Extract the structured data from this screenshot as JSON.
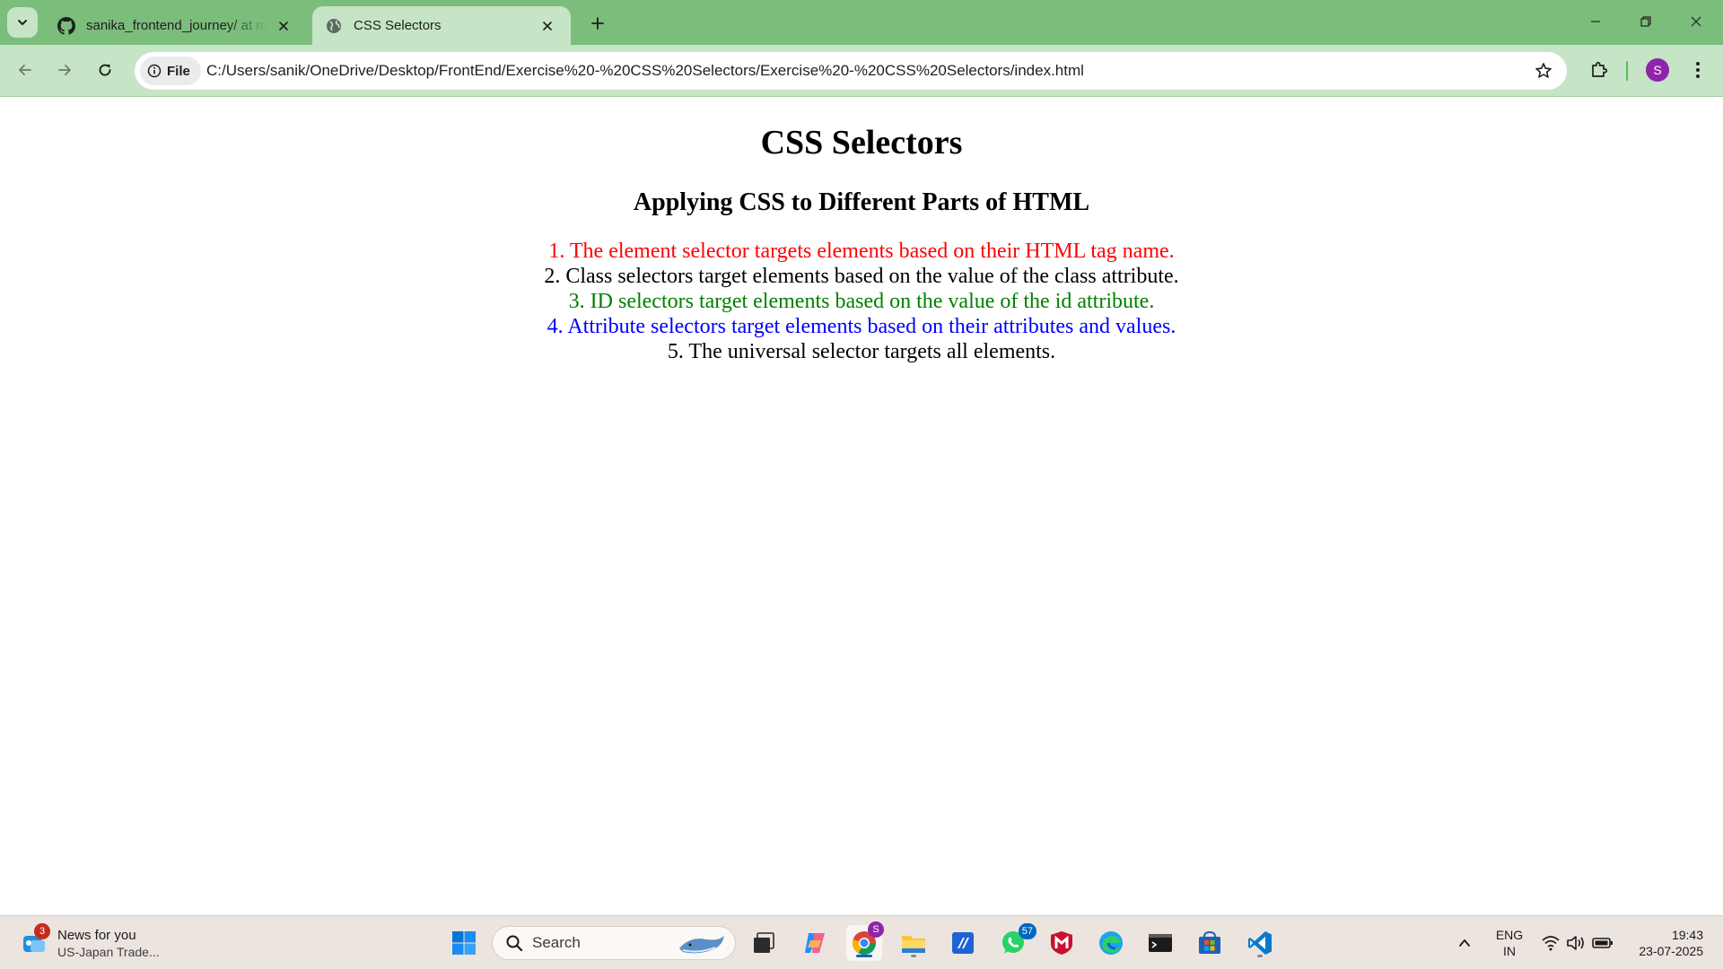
{
  "browser": {
    "tabs": [
      {
        "title": "sanika_frontend_journey/ at main",
        "icon": "github-icon",
        "active": false
      },
      {
        "title": "CSS Selectors",
        "icon": "globe-icon",
        "active": true
      }
    ],
    "address_bar": {
      "chip_label": "File",
      "url": "C:/Users/sanik/OneDrive/Desktop/FrontEnd/Exercise%20-%20CSS%20Selectors/Exercise%20-%20CSS%20Selectors/index.html"
    },
    "profile_initial": "S",
    "colors": {
      "frame": "#7bbd7b",
      "toolbar": "#c6e4c6"
    }
  },
  "page": {
    "title": "CSS Selectors",
    "subtitle": "Applying CSS to Different Parts of HTML",
    "items": [
      {
        "text": "1. The element selector targets elements based on their HTML tag name.",
        "color": "#ff0000"
      },
      {
        "text": "2. Class selectors target elements based on the value of the class attribute.",
        "color": "#000000"
      },
      {
        "text": "3. ID selectors target elements based on the value of the id attribute.",
        "color": "#008000"
      },
      {
        "text": "4. Attribute selectors target elements based on their attributes and values.",
        "color": "#0000ff"
      },
      {
        "text": "5. The universal selector targets all elements.",
        "color": "#000000"
      }
    ]
  },
  "taskbar": {
    "news": {
      "title": "News for you",
      "subtitle": "US-Japan Trade...",
      "badge": "3"
    },
    "search_label": "Search",
    "apps": [
      {
        "name": "start-icon"
      },
      {
        "name": "task-view-icon"
      },
      {
        "name": "copilot-icon"
      },
      {
        "name": "chrome-icon",
        "badge": "S",
        "running": "active"
      },
      {
        "name": "file-explorer-icon",
        "running": "inactive"
      },
      {
        "name": "sticky-app-icon"
      },
      {
        "name": "whatsapp-icon",
        "badge": "57"
      },
      {
        "name": "mcafee-icon"
      },
      {
        "name": "edge-icon"
      },
      {
        "name": "terminal-icon"
      },
      {
        "name": "store-icon"
      },
      {
        "name": "vscode-icon",
        "running": "inactive"
      }
    ],
    "language": {
      "line1": "ENG",
      "line2": "IN"
    },
    "clock": {
      "time": "19:43",
      "date": "23-07-2025"
    }
  }
}
